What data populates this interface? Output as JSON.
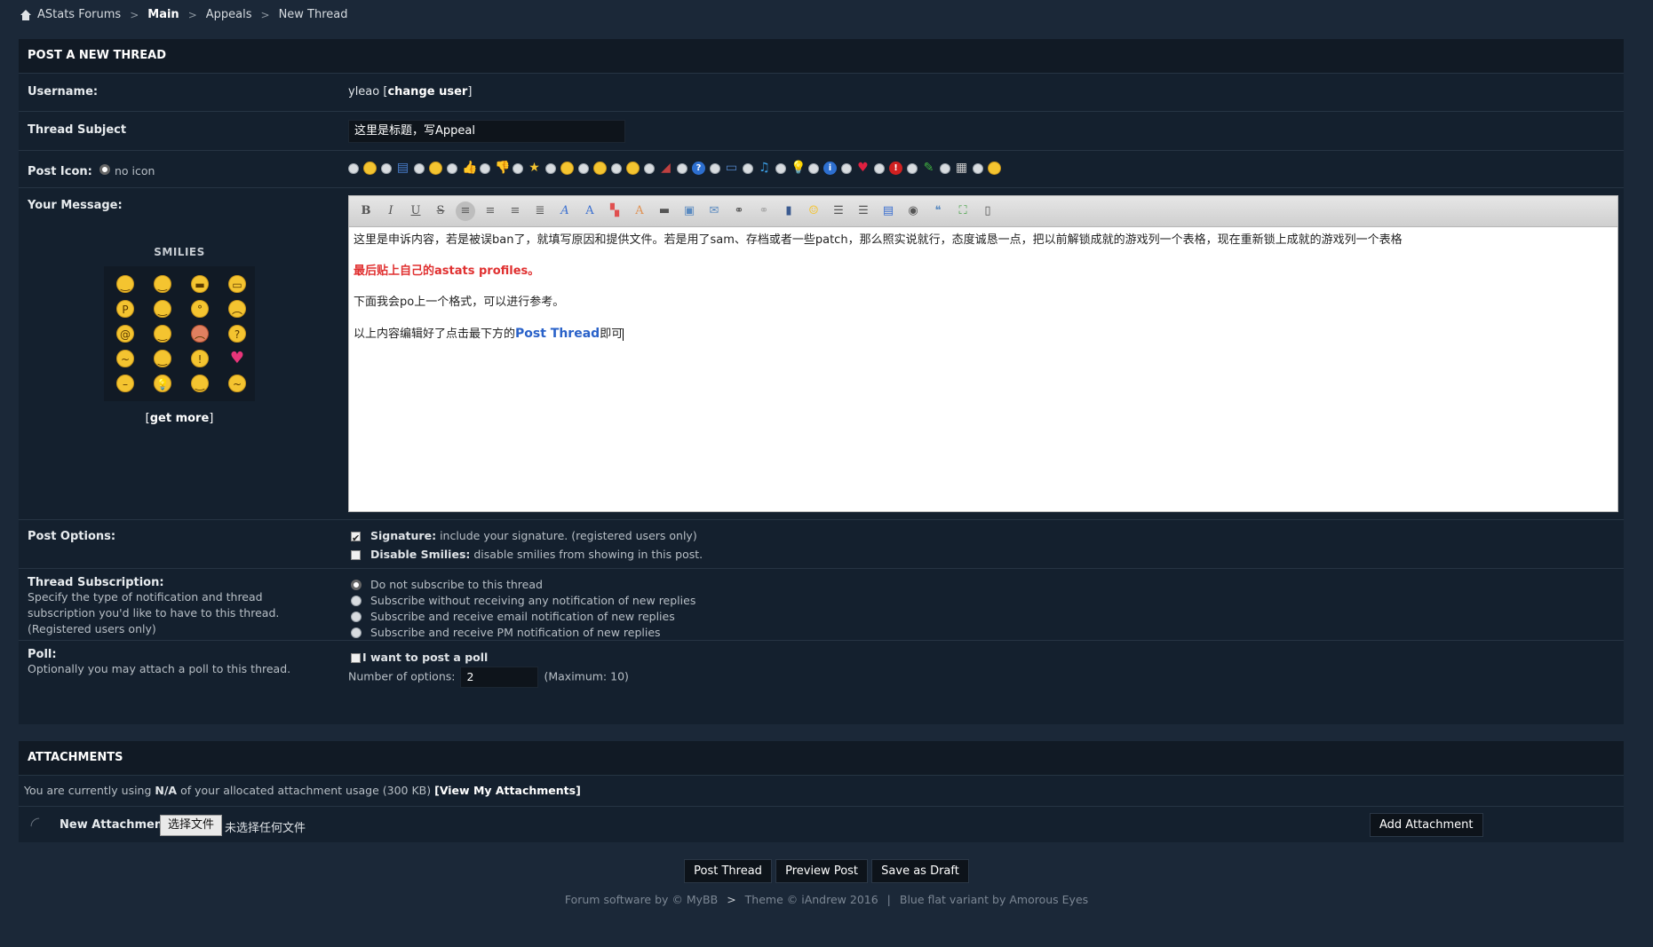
{
  "breadcrumb": {
    "home": "AStats Forums",
    "main": "Main",
    "appeals": "Appeals",
    "current": "New Thread"
  },
  "form": {
    "title": "POST A NEW THREAD",
    "username_label": "Username:",
    "username": "yleao",
    "change_user": "change user",
    "subject_label": "Thread Subject",
    "subject_value": "这里是标题，写Appeal",
    "post_icon_label": "Post Icon:",
    "no_icon": "no icon",
    "message_label": "Your Message:",
    "smilies_title": "SMILIES",
    "get_more": "get more"
  },
  "message": {
    "line1": "这里是申诉内容，若是被误ban了，就填写原因和提供文件。若是用了sam、存档或者一些patch，那么照实说就行，态度诚恳一点，把以前解锁成就的游戏列一个表格，现在重新锁上成就的游戏列一个表格",
    "line2": "最后贴上自己的astats profiles。",
    "line3": "下面我会po上一个格式，可以进行参考。",
    "line4_a": "以上内容编辑好了点击最下方的",
    "line4_b": "Post Thread",
    "line4_c": "即可"
  },
  "options": {
    "label": "Post Options:",
    "signature_b": "Signature:",
    "signature": "include your signature. (registered users only)",
    "smilies_b": "Disable Smilies:",
    "smilies": "disable smilies from showing in this post."
  },
  "subscription": {
    "label": "Thread Subscription:",
    "desc": "Specify the type of notification and thread subscription you'd like to have to this thread. (Registered users only)",
    "choices": [
      "Do not subscribe to this thread",
      "Subscribe without receiving any notification of new replies",
      "Subscribe and receive email notification of new replies",
      "Subscribe and receive PM notification of new replies"
    ]
  },
  "poll": {
    "label": "Poll:",
    "desc": "Optionally you may attach a poll to this thread.",
    "want_poll": "I want to post a poll",
    "num_label": "Number of options:",
    "num_value": "2",
    "max": "(Maximum: 10)"
  },
  "attachments": {
    "title": "ATTACHMENTS",
    "usage_a": "You are currently using",
    "usage_b": "N/A",
    "usage_c": "of your allocated attachment usage (300 KB)",
    "view": "[View My Attachments]",
    "new_label": "New Attachment:",
    "file_button": "选择文件",
    "no_file": "未选择任何文件",
    "add_button": "Add Attachment"
  },
  "buttons": {
    "post": "Post Thread",
    "preview": "Preview Post",
    "draft": "Save as Draft"
  },
  "footer": {
    "a": "Forum software by © MyBB",
    "b": "Theme © iAndrew 2016",
    "c": "Blue flat variant by Amorous Eyes"
  }
}
